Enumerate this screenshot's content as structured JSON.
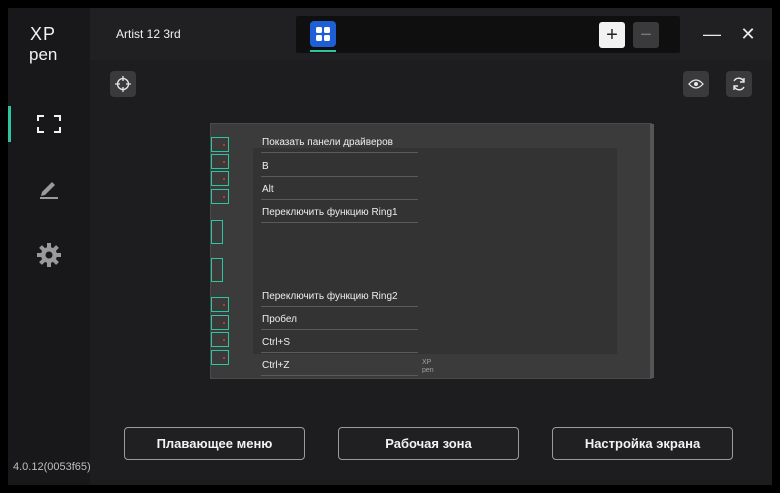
{
  "app": {
    "device_name": "Artist 12 3rd",
    "version": "4.0.12(0053f65)",
    "logo_icon": "xp-pen-logo-icon"
  },
  "sidebar": {
    "items": [
      {
        "id": "display",
        "icon": "screen-frame-icon",
        "active": true
      },
      {
        "id": "pen",
        "icon": "pen-icon",
        "active": false
      },
      {
        "id": "settings",
        "icon": "gear-icon",
        "active": false
      }
    ]
  },
  "tabs": {
    "apps": [
      {
        "icon": "all-apps-grid-icon",
        "selected": true
      }
    ],
    "add_label": "+",
    "remove_label": "−"
  },
  "window_controls": {
    "minimize": "—",
    "close": "✕"
  },
  "tablet": {
    "logo_icon": "xp-pen-logo-icon",
    "express_keys": [
      "Показать панели драйверов",
      "B",
      "Alt",
      "Переключить функцию Ring1",
      "Переключить функцию Ring2",
      "Пробел",
      "Ctrl+S",
      "Ctrl+Z"
    ]
  },
  "buttons": {
    "floating_menu": "Плавающее меню",
    "work_area": "Рабочая зона",
    "display_settings": "Настройка экрана"
  },
  "colors": {
    "accent": "#2ec4a0",
    "app_tab": "#1f5fd6",
    "background": "#1d1d1f"
  }
}
